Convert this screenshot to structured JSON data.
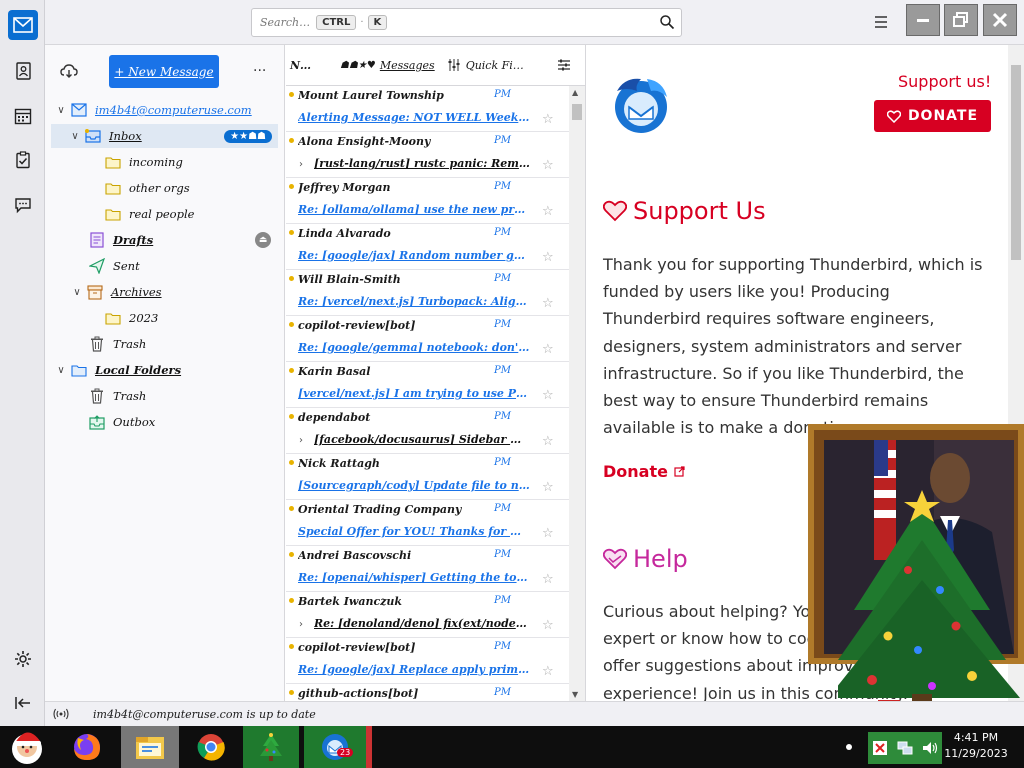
{
  "titlebar": {
    "search_placeholder": "Search…",
    "kbd_ctrl": "CTRL",
    "kbd_sep": "·",
    "kbd_k": "K"
  },
  "folder_pane": {
    "new_message_label": "+ New Message",
    "more_label": "···",
    "items": [
      {
        "label": "im4b4t@computeruse.com",
        "level": 0,
        "icon": "account-icon"
      },
      {
        "label": "Inbox",
        "level": 1,
        "icon": "inbox-icon",
        "badge": "unread"
      },
      {
        "label": "incoming",
        "level": 2,
        "icon": "folder-icon"
      },
      {
        "label": "other orgs",
        "level": 2,
        "icon": "folder-icon"
      },
      {
        "label": "real people",
        "level": 2,
        "icon": "folder-icon"
      },
      {
        "label": "Drafts",
        "level": 1,
        "icon": "drafts-icon"
      },
      {
        "label": "Sent",
        "level": 1,
        "icon": "sent-icon"
      },
      {
        "label": "Archives",
        "level": 1,
        "icon": "archive-icon"
      },
      {
        "label": "2023",
        "level": 2,
        "icon": "folder-icon"
      },
      {
        "label": "Trash",
        "level": 1,
        "icon": "trash-icon"
      },
      {
        "label": "Local Folders",
        "level": 0,
        "icon": "local-folders-icon"
      },
      {
        "label": "Trash",
        "level": 1,
        "icon": "trash-icon"
      },
      {
        "label": "Outbox",
        "level": 1,
        "icon": "outbox-icon"
      }
    ]
  },
  "thread_pane": {
    "header_col1": "N…",
    "header_col2": "Messages",
    "header_col3": "Quick Fi…",
    "rows": [
      {
        "from": "Mount Laurel Township",
        "date": "PM",
        "subject": "Alerting Message: NOT WELL Weekly …",
        "thread": false
      },
      {
        "from": "Alona Ensight-Moony",
        "date": "PM",
        "subject": "[rust-lang/rust] rustc panic: Remove unused…",
        "thread": true
      },
      {
        "from": "Jeffrey Morgan",
        "date": "PM",
        "subject": "Re: [ollama/ollama] use the new pref…",
        "thread": false
      },
      {
        "from": "Linda Alvarado",
        "date": "PM",
        "subject": "Re: [google/jax] Random number generation…",
        "thread": false
      },
      {
        "from": "Will Blain-Smith",
        "date": "PM",
        "subject": "Re: [vercel/next.js] Turbopack: Align some…",
        "thread": false
      },
      {
        "from": "copilot-review[bot]",
        "date": "PM",
        "subject": "Re: [google/gemma] notebook: don't TeST …",
        "thread": false
      },
      {
        "from": "Karin Basal",
        "date": "PM",
        "subject": "[vercel/next.js] I am trying to use Provider…",
        "thread": false
      },
      {
        "from": "dependabot",
        "date": "PM",
        "subject": "[facebook/docusaurus] Sidebar Html doesn't…",
        "thread": true
      },
      {
        "from": "Nick Rattagh",
        "date": "PM",
        "subject": "[Sourcegraph/cody] Update file to not BigFile…",
        "thread": false
      },
      {
        "from": "Oriental Trading Company",
        "date": "PM",
        "subject": "Special Offer for YOU! Thanks for Our…",
        "thread": false
      },
      {
        "from": "Andrei Bascovschi",
        "date": "PM",
        "subject": "Re: [openai/whisper] Getting the top four …",
        "thread": false
      },
      {
        "from": "Bartek Iwanczuk",
        "date": "PM",
        "subject": "Re: [denoland/deno] fix(ext/node): add sta…",
        "thread": true
      },
      {
        "from": "copilot-review[bot]",
        "date": "PM",
        "subject": "Re: [google/jax] Replace apply primitive wit…",
        "thread": false
      },
      {
        "from": "github-actions[bot]",
        "date": "PM",
        "subject": "",
        "thread": false
      }
    ]
  },
  "message_pane": {
    "support_link": "Support us!",
    "donate_button": "DONATE",
    "support_heading": "Support Us",
    "support_text": "Thank you for supporting Thunderbird, which is funded by users like you! Producing Thunderbird requires software engineers, designers, system administrators and server infrastructure. So if you like Thunderbird, the best way to ensure Thunderbird remains available is to make a donation.",
    "donate_link": "Donate",
    "help_heading": "Help",
    "help_text": "Curious about helping? You don't need to be an expert or know how to code. Report bugs, or offer suggestions about improving your experience! Join us in this community."
  },
  "statusbar": {
    "text": "im4b4t@computeruse.com is up to date"
  },
  "taskbar": {
    "clock_time": "4:41 PM",
    "clock_date": "11/29/2023",
    "thunderbird_badge": "23"
  },
  "colors": {
    "accent": "#0a6ed1",
    "donate_red": "#d70022",
    "help_pink": "#c5289c"
  }
}
